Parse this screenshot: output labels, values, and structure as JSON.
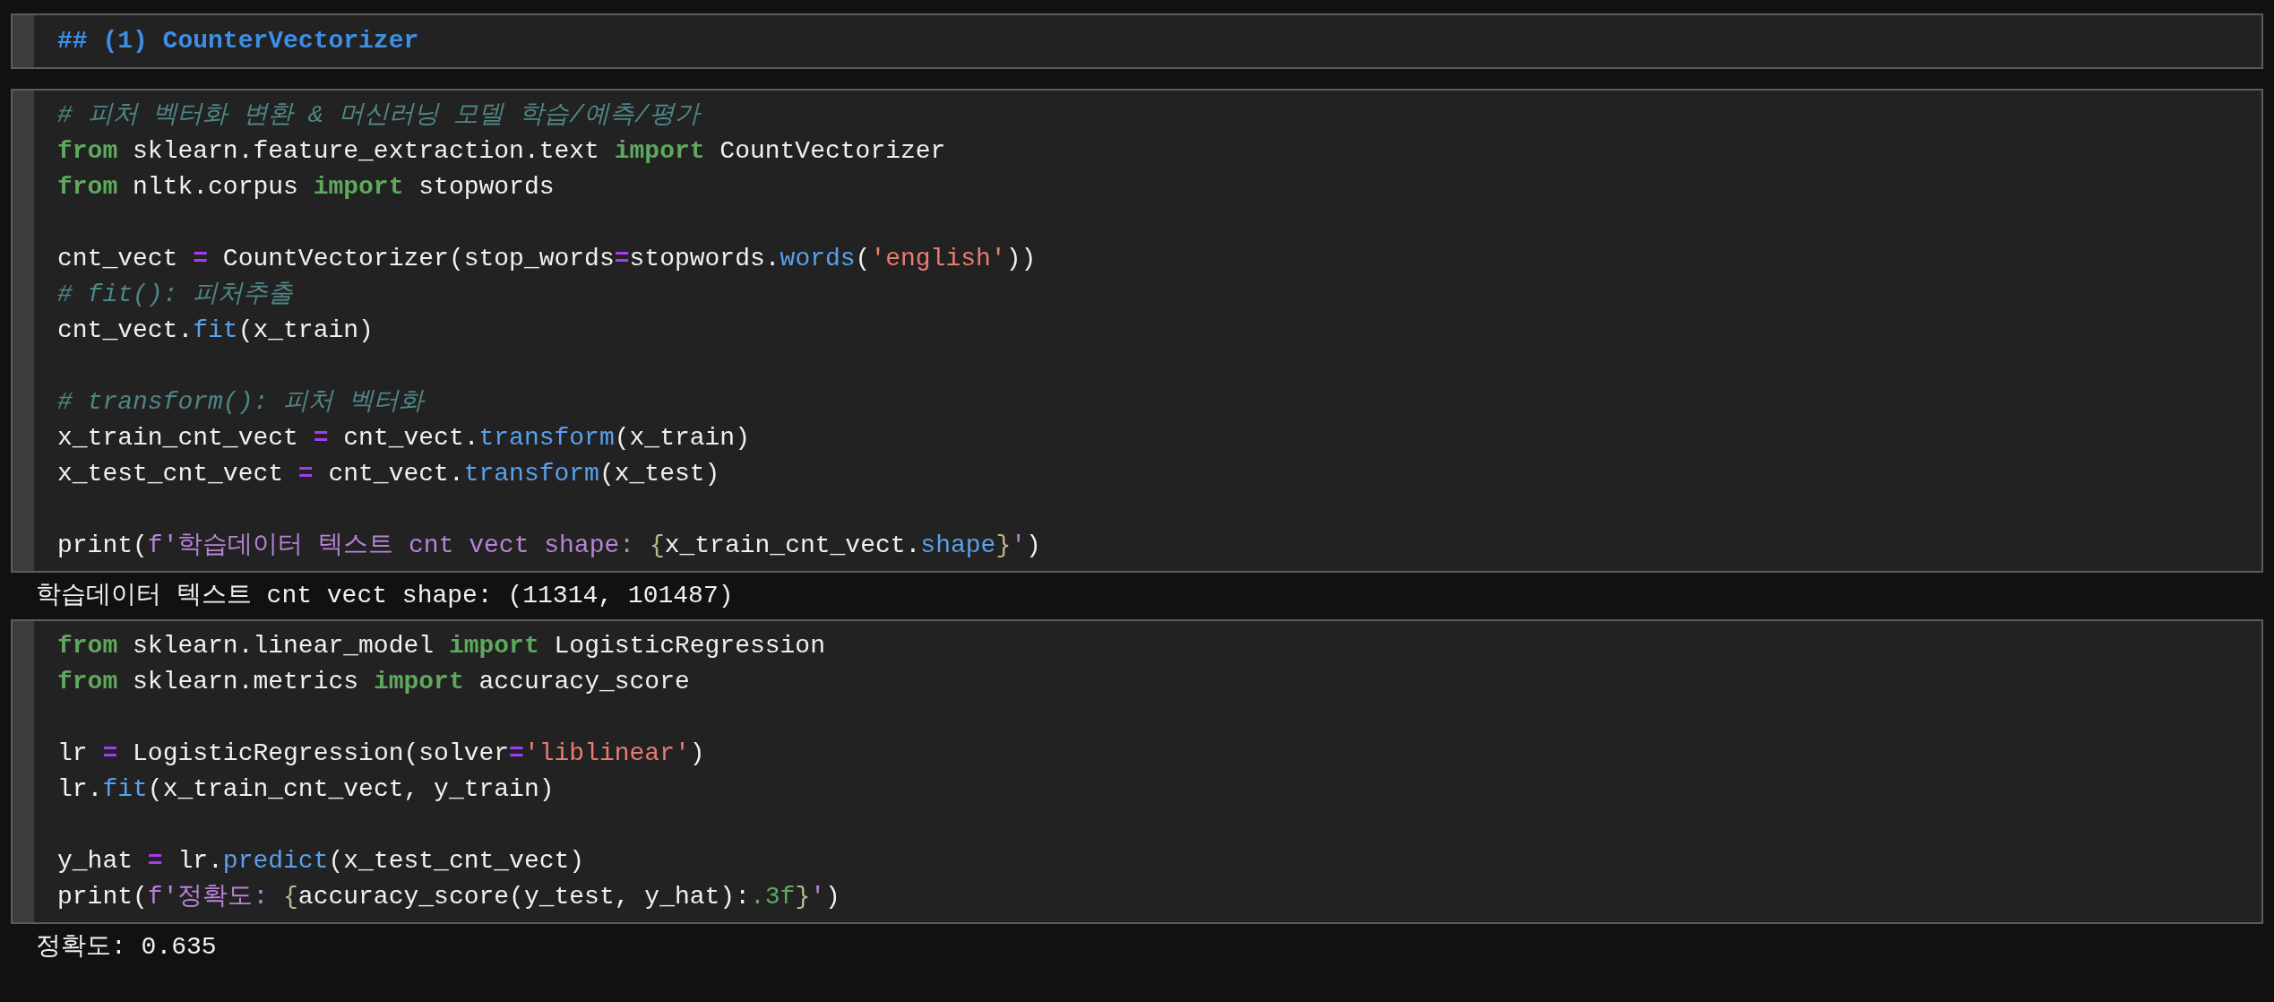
{
  "cells": [
    {
      "kind": "markdown",
      "text": "## (1) CounterVectorizer"
    },
    {
      "kind": "code",
      "blocks": [
        [
          [
            {
              "kind": "comment",
              "text": "# 피처 벡터화 변환 & 머신러닝 모델 학습/예측/평가"
            }
          ],
          [
            {
              "kind": "keyword",
              "text": "from"
            },
            {
              "kind": "plain",
              "text": " sklearn.feature_extraction.text "
            },
            {
              "kind": "keyword",
              "text": "import"
            },
            {
              "kind": "plain",
              "text": " CountVectorizer"
            }
          ],
          [
            {
              "kind": "keyword",
              "text": "from"
            },
            {
              "kind": "plain",
              "text": " nltk.corpus "
            },
            {
              "kind": "keyword",
              "text": "import"
            },
            {
              "kind": "plain",
              "text": " stopwords"
            }
          ]
        ],
        [
          [
            {
              "kind": "plain",
              "text": "cnt_vect "
            },
            {
              "kind": "operator",
              "text": "="
            },
            {
              "kind": "plain",
              "text": " CountVectorizer(stop_words"
            },
            {
              "kind": "operator",
              "text": "="
            },
            {
              "kind": "plain",
              "text": "stopwords."
            },
            {
              "kind": "function",
              "text": "words"
            },
            {
              "kind": "plain",
              "text": "("
            },
            {
              "kind": "string",
              "text": "'english'"
            },
            {
              "kind": "plain",
              "text": "))"
            }
          ],
          [
            {
              "kind": "comment",
              "text": "# fit(): 피처추출"
            }
          ],
          [
            {
              "kind": "plain",
              "text": "cnt_vect."
            },
            {
              "kind": "function",
              "text": "fit"
            },
            {
              "kind": "plain",
              "text": "(x_train)"
            }
          ]
        ],
        [
          [
            {
              "kind": "comment",
              "text": "# transform(): 피처 벡터화"
            }
          ],
          [
            {
              "kind": "plain",
              "text": "x_train_cnt_vect "
            },
            {
              "kind": "operator",
              "text": "="
            },
            {
              "kind": "plain",
              "text": " cnt_vect."
            },
            {
              "kind": "function",
              "text": "transform"
            },
            {
              "kind": "plain",
              "text": "(x_train)"
            }
          ],
          [
            {
              "kind": "plain",
              "text": "x_test_cnt_vect "
            },
            {
              "kind": "operator",
              "text": "="
            },
            {
              "kind": "plain",
              "text": " cnt_vect."
            },
            {
              "kind": "function",
              "text": "transform"
            },
            {
              "kind": "plain",
              "text": "(x_test)"
            }
          ]
        ],
        [
          [
            {
              "kind": "plain",
              "text": "print("
            },
            {
              "kind": "fstring",
              "text": "f'학습데이터 텍스트 cnt vect shape: "
            },
            {
              "kind": "brace",
              "text": "{"
            },
            {
              "kind": "plain",
              "text": "x_train_cnt_vect."
            },
            {
              "kind": "function",
              "text": "shape"
            },
            {
              "kind": "brace",
              "text": "}"
            },
            {
              "kind": "fstring",
              "text": "'"
            },
            {
              "kind": "plain",
              "text": ")"
            }
          ]
        ]
      ],
      "output": "학습데이터 텍스트 cnt vect shape: (11314, 101487)"
    },
    {
      "kind": "code",
      "blocks": [
        [
          [
            {
              "kind": "keyword",
              "text": "from"
            },
            {
              "kind": "plain",
              "text": " sklearn.linear_model "
            },
            {
              "kind": "keyword",
              "text": "import"
            },
            {
              "kind": "plain",
              "text": " LogisticRegression"
            }
          ],
          [
            {
              "kind": "keyword",
              "text": "from"
            },
            {
              "kind": "plain",
              "text": " sklearn.metrics "
            },
            {
              "kind": "keyword",
              "text": "import"
            },
            {
              "kind": "plain",
              "text": " accuracy_score"
            }
          ]
        ],
        [
          [
            {
              "kind": "plain",
              "text": "lr "
            },
            {
              "kind": "operator",
              "text": "="
            },
            {
              "kind": "plain",
              "text": " LogisticRegression(solver"
            },
            {
              "kind": "operator",
              "text": "="
            },
            {
              "kind": "string",
              "text": "'liblinear'"
            },
            {
              "kind": "plain",
              "text": ")"
            }
          ],
          [
            {
              "kind": "plain",
              "text": "lr."
            },
            {
              "kind": "function",
              "text": "fit"
            },
            {
              "kind": "plain",
              "text": "(x_train_cnt_vect, y_train)"
            }
          ]
        ],
        [
          [
            {
              "kind": "plain",
              "text": "y_hat "
            },
            {
              "kind": "operator",
              "text": "="
            },
            {
              "kind": "plain",
              "text": " lr."
            },
            {
              "kind": "function",
              "text": "predict"
            },
            {
              "kind": "plain",
              "text": "(x_test_cnt_vect)"
            }
          ],
          [
            {
              "kind": "plain",
              "text": "print("
            },
            {
              "kind": "fstring",
              "text": "f'정확도: "
            },
            {
              "kind": "brace",
              "text": "{"
            },
            {
              "kind": "plain",
              "text": "accuracy_score(y_test, y_hat):"
            },
            {
              "kind": "spec",
              "text": ".3f"
            },
            {
              "kind": "brace",
              "text": "}"
            },
            {
              "kind": "fstring",
              "text": "'"
            },
            {
              "kind": "plain",
              "text": ")"
            }
          ]
        ]
      ],
      "output": "정확도: 0.635"
    }
  ]
}
